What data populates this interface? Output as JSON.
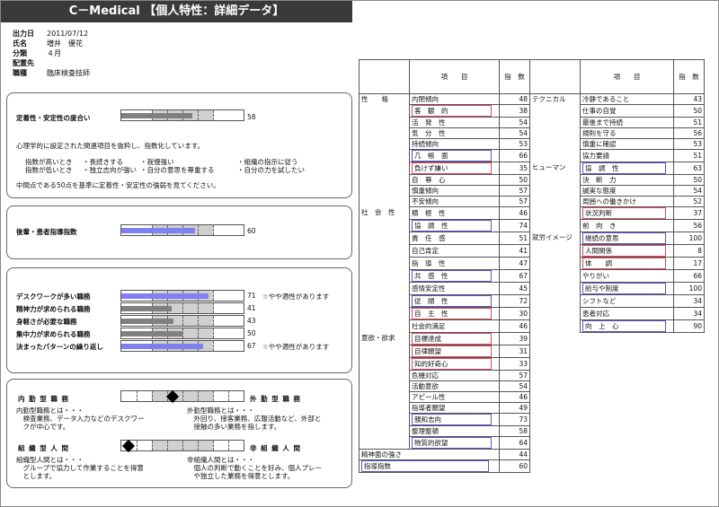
{
  "title": "C－Medical 【個人特性：詳細データ】",
  "info": {
    "rows": [
      {
        "key": "出力日",
        "value": "2011/07/12"
      },
      {
        "key": "氏名",
        "value": "増井　優花"
      },
      {
        "key": "分類",
        "value": "４月"
      },
      {
        "key": "配置先",
        "value": ""
      },
      {
        "key": "職種",
        "value": "臨床検査技師"
      }
    ]
  },
  "teichaku": {
    "label": "定着性・安定性の度合い",
    "value": 58,
    "value_text": "58",
    "color": "#808080",
    "desc1": "心理学的に設定された関連項目を抜粋し、指数化しています。",
    "high_label": "指数が高いとき",
    "high_items": [
      "・長続きする",
      "・我慢強い",
      "・組織の指示に従う"
    ],
    "low_label": "指数が低いとき",
    "low_items": [
      "・独立志向が強い",
      "・自分の意思を尊重する",
      "・自分の力を試したい"
    ],
    "desc2": "中間点である50点を基準に定着性・安定性の強弱を見てください。"
  },
  "kohai": {
    "label": "後輩・患者指導指数",
    "value": 60,
    "value_text": "60",
    "color": "#8080f0"
  },
  "jobs": [
    {
      "label": "デスクワークが多い職務",
      "value": 71,
      "value_text": "71",
      "note": "☆やや適性があります",
      "color": "#8080f0"
    },
    {
      "label": "精神力が求められる職務",
      "value": 41,
      "value_text": "41",
      "note": "",
      "color": "#808080"
    },
    {
      "label": "身軽さが必要な職務",
      "value": 43,
      "value_text": "43",
      "note": "",
      "color": "#808080"
    },
    {
      "label": "集中力が求められる職務",
      "value": 50,
      "value_text": "50",
      "note": "",
      "color": "#808080"
    },
    {
      "label": "決まったパターンの繰り返し",
      "value": 67,
      "value_text": "67",
      "note": "☆やや適性があります",
      "color": "#8080f0"
    }
  ],
  "naigai": {
    "left_title": "内 勤 型 職 務",
    "right_title": "外 勤 型 職 務",
    "position": 0.42,
    "left_desc": [
      "内勤型職務とは・・・",
      "　検査業務、データ入力などのデスクワー",
      "　クが中心です。"
    ],
    "right_desc": [
      "外勤型職務とは・・・",
      "　外回り、接客業務、広報活動など、外部と",
      "　接触の多い業務を指します。"
    ]
  },
  "soshiki": {
    "left_title": "組 織 型 人 間",
    "right_title": "非 組 織 人 間",
    "position": 0.06,
    "left_desc": [
      "組織型人間とは・・・",
      "　グループで協力して作業することを得意",
      "　とします。"
    ],
    "right_desc": [
      "非組織人間とは・・・",
      "　個人の判断で動くことを好み、個人プレー",
      "　や独立した業務を得意とします。"
    ]
  },
  "table": {
    "header_item": "項　　目",
    "header_index": "指　数",
    "left_rows": [
      {
        "cat": "性　　格",
        "item": "内閉傾向",
        "val": "48",
        "box": ""
      },
      {
        "cat": "",
        "item": "客　観　的",
        "val": "38",
        "box": "red"
      },
      {
        "cat": "",
        "item": "活　発　性",
        "val": "54",
        "box": ""
      },
      {
        "cat": "",
        "item": "気　分　性",
        "val": "54",
        "box": ""
      },
      {
        "cat": "",
        "item": "持続傾向",
        "val": "53",
        "box": ""
      },
      {
        "cat": "",
        "item": "几　帳　面",
        "val": "66",
        "box": "blue"
      },
      {
        "cat": "",
        "item": "負けず嫌い",
        "val": "35",
        "box": "red"
      },
      {
        "cat": "",
        "item": "自　尊　心",
        "val": "50",
        "box": ""
      },
      {
        "cat": "",
        "item": "慎重傾向",
        "val": "57",
        "box": ""
      },
      {
        "cat": "",
        "item": "不安傾向",
        "val": "57",
        "box": ""
      },
      {
        "cat": "社　会　性",
        "item": "積　極　性",
        "val": "46",
        "box": ""
      },
      {
        "cat": "",
        "item": "協　調　性",
        "val": "74",
        "box": "blue"
      },
      {
        "cat": "",
        "item": "責　任　感",
        "val": "51",
        "box": ""
      },
      {
        "cat": "",
        "item": "自己肯定",
        "val": "41",
        "box": ""
      },
      {
        "cat": "",
        "item": "指　導　性",
        "val": "47",
        "box": ""
      },
      {
        "cat": "",
        "item": "共　感　性",
        "val": "67",
        "box": "blue"
      },
      {
        "cat": "",
        "item": "感情安定性",
        "val": "45",
        "box": ""
      },
      {
        "cat": "",
        "item": "従　順　性",
        "val": "72",
        "box": "blue"
      },
      {
        "cat": "",
        "item": "自　主　性",
        "val": "30",
        "box": "red"
      },
      {
        "cat": "",
        "item": "社会的満足",
        "val": "46",
        "box": ""
      },
      {
        "cat": "意欲・欲求",
        "item": "目標達成",
        "val": "39",
        "box": "red"
      },
      {
        "cat": "",
        "item": "自律願望",
        "val": "31",
        "box": "red"
      },
      {
        "cat": "",
        "item": "知的好奇心",
        "val": "33",
        "box": "red"
      },
      {
        "cat": "",
        "item": "危機対応",
        "val": "57",
        "box": ""
      },
      {
        "cat": "",
        "item": "活動意欲",
        "val": "54",
        "box": ""
      },
      {
        "cat": "",
        "item": "アピール性",
        "val": "46",
        "box": ""
      },
      {
        "cat": "",
        "item": "指導者願望",
        "val": "49",
        "box": ""
      },
      {
        "cat": "",
        "item": "親和志向",
        "val": "73",
        "box": "blue"
      },
      {
        "cat": "",
        "item": "整理整頓",
        "val": "58",
        "box": ""
      },
      {
        "cat": "",
        "item": "物質的欲望",
        "val": "64",
        "box": "blue"
      }
    ],
    "right_rows": [
      {
        "cat": "テクニカル",
        "item": "冷静であること",
        "val": "43",
        "box": ""
      },
      {
        "cat": "",
        "item": "仕事の自覚",
        "val": "50",
        "box": ""
      },
      {
        "cat": "",
        "item": "最後まで持続",
        "val": "51",
        "box": ""
      },
      {
        "cat": "",
        "item": "規則を守る",
        "val": "56",
        "box": ""
      },
      {
        "cat": "",
        "item": "慎重に確認",
        "val": "53",
        "box": ""
      },
      {
        "cat": "",
        "item": "協力要請",
        "val": "51",
        "box": ""
      },
      {
        "cat": "ヒューマン",
        "item": "協　調　性",
        "val": "63",
        "box": "blue"
      },
      {
        "cat": "",
        "item": "決　断　力",
        "val": "50",
        "box": ""
      },
      {
        "cat": "",
        "item": "誠実な態度",
        "val": "54",
        "box": ""
      },
      {
        "cat": "",
        "item": "周囲への働きかけ",
        "val": "52",
        "box": ""
      },
      {
        "cat": "",
        "item": "状況判断",
        "val": "37",
        "box": "red"
      },
      {
        "cat": "",
        "item": "前　向　き",
        "val": "56",
        "box": ""
      },
      {
        "cat": "就労イメージ",
        "item": "継続の意思",
        "val": "100",
        "box": "blue"
      },
      {
        "cat": "",
        "item": "人間関係",
        "val": "8",
        "box": "red"
      },
      {
        "cat": "",
        "item": "体　　調",
        "val": "17",
        "box": "red"
      },
      {
        "cat": "",
        "item": "やりがい",
        "val": "66",
        "box": ""
      },
      {
        "cat": "",
        "item": "給与や制度",
        "val": "100",
        "box": "blue"
      },
      {
        "cat": "",
        "item": "シフトなど",
        "val": "34",
        "box": ""
      },
      {
        "cat": "",
        "item": "患者対応",
        "val": "34",
        "box": ""
      },
      {
        "cat": "",
        "item": "向　上　心",
        "val": "90",
        "box": "blue"
      }
    ],
    "bottom_rows": [
      {
        "label": "精神面の強さ",
        "val": "44",
        "box": ""
      },
      {
        "label": "指導指数",
        "val": "60",
        "box": "blue"
      }
    ]
  },
  "colors": {
    "red_box": "#d94b5a",
    "blue_box": "#5a55c6",
    "grey_bar": "#808080",
    "blue_bar": "#8080f0"
  }
}
